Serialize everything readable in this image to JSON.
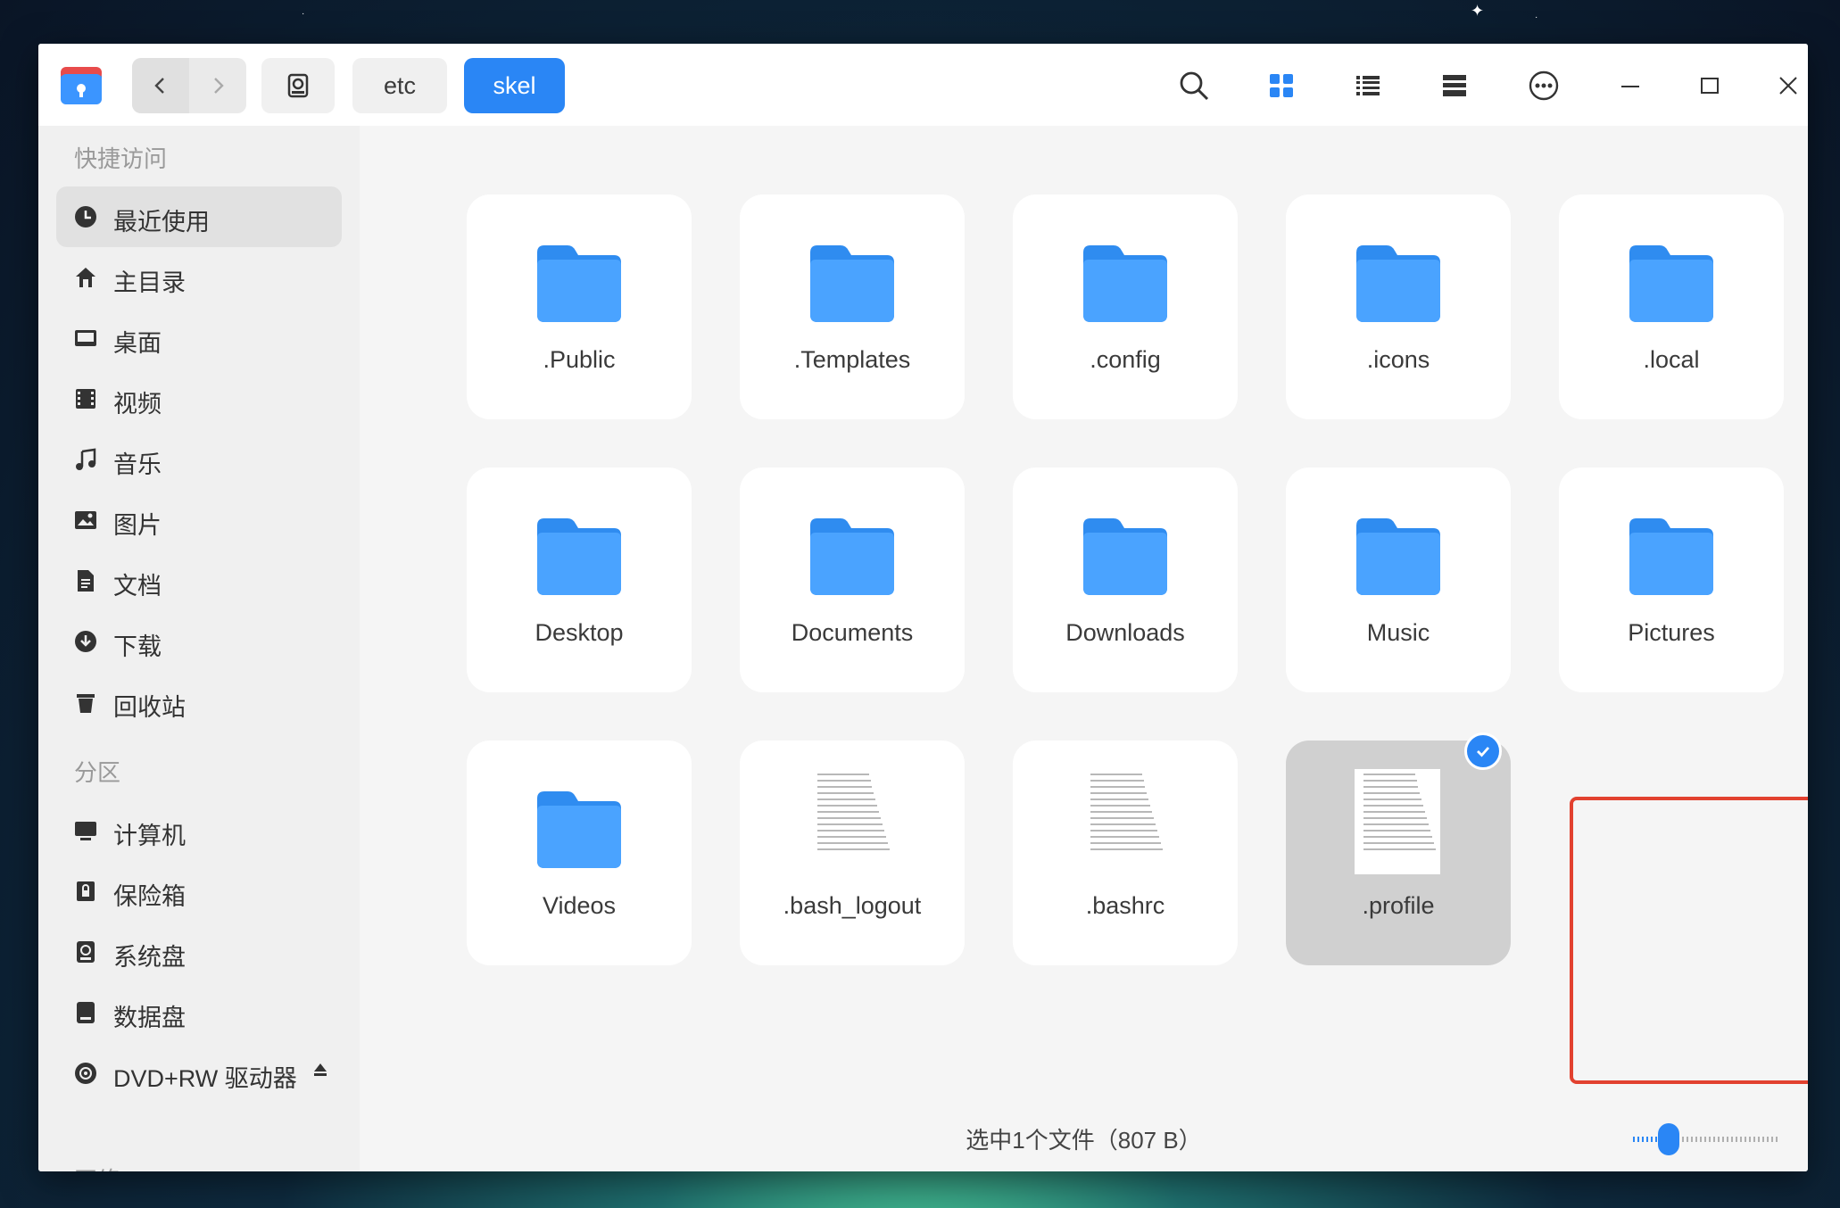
{
  "titlebar": {
    "breadcrumbs": [
      {
        "label": "etc",
        "active": false
      },
      {
        "label": "skel",
        "active": true
      }
    ],
    "icons": [
      "search-icon",
      "grid-view-icon",
      "list-view-icon",
      "tree-view-icon",
      "more-icon",
      "minimize-icon",
      "maximize-icon",
      "close-icon"
    ],
    "accent": "#2a86f5"
  },
  "sidebar": {
    "quick_access_title": "快捷访问",
    "quick_access": [
      {
        "label": "最近使用",
        "icon": "clock-icon",
        "active": true
      },
      {
        "label": "主目录",
        "icon": "home-icon"
      },
      {
        "label": "桌面",
        "icon": "desktop-icon"
      },
      {
        "label": "视频",
        "icon": "film-icon"
      },
      {
        "label": "音乐",
        "icon": "music-note-icon"
      },
      {
        "label": "图片",
        "icon": "image-icon"
      },
      {
        "label": "文档",
        "icon": "document-icon"
      },
      {
        "label": "下载",
        "icon": "download-icon"
      },
      {
        "label": "回收站",
        "icon": "trash-icon"
      }
    ],
    "partitions_title": "分区",
    "partitions": [
      {
        "label": "计算机",
        "icon": "computer-icon"
      },
      {
        "label": "保险箱",
        "icon": "vault-icon"
      },
      {
        "label": "系统盘",
        "icon": "system-disk-icon"
      },
      {
        "label": "数据盘",
        "icon": "data-disk-icon"
      },
      {
        "label": "DVD+RW 驱动器",
        "icon": "disc-icon"
      }
    ],
    "network_title": "网络"
  },
  "files": [
    {
      "name": ".Public",
      "type": "folder"
    },
    {
      "name": ".Templates",
      "type": "folder"
    },
    {
      "name": ".config",
      "type": "folder"
    },
    {
      "name": ".icons",
      "type": "folder"
    },
    {
      "name": ".local",
      "type": "folder"
    },
    {
      "name": "Desktop",
      "type": "folder"
    },
    {
      "name": "Documents",
      "type": "folder"
    },
    {
      "name": "Downloads",
      "type": "folder"
    },
    {
      "name": "Music",
      "type": "folder"
    },
    {
      "name": "Pictures",
      "type": "folder"
    },
    {
      "name": "Videos",
      "type": "folder"
    },
    {
      "name": ".bash_logout",
      "type": "text"
    },
    {
      "name": ".bashrc",
      "type": "text"
    },
    {
      "name": ".profile",
      "type": "text",
      "selected": true
    }
  ],
  "status": {
    "text": "选中1个文件（807 B）"
  },
  "zoom_level": 0.2
}
